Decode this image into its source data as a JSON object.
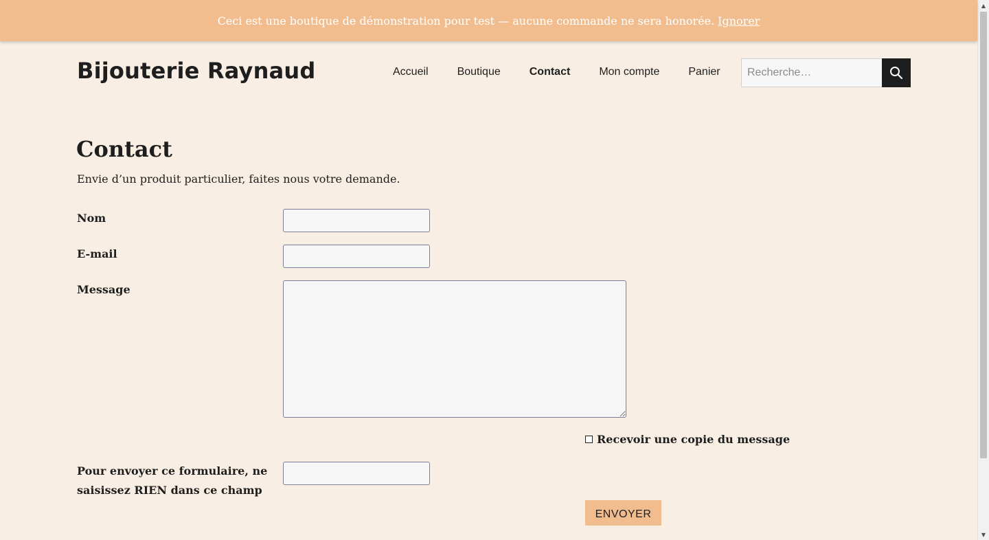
{
  "banner": {
    "text": "Ceci est une boutique de démonstration pour test — aucune commande ne sera honorée.",
    "dismiss_label": "Ignorer"
  },
  "site": {
    "title": "Bijouterie Raynaud"
  },
  "nav": {
    "items": [
      {
        "label": "Accueil"
      },
      {
        "label": "Boutique"
      },
      {
        "label": "Contact"
      },
      {
        "label": "Mon compte"
      },
      {
        "label": "Panier"
      }
    ],
    "active": "Contact"
  },
  "search": {
    "placeholder": "Recherche…",
    "icon": "search-icon"
  },
  "page": {
    "title": "Contact",
    "intro": "Envie d’un produit particulier, faites nous votre demande."
  },
  "form": {
    "name_label": "Nom",
    "email_label": "E-mail",
    "message_label": "Message",
    "copy_label": "Recevoir une copie du message",
    "honeypot_label_line1": "Pour envoyer ce formulaire, ne",
    "honeypot_label_line2": "saisissez RIEN dans ce champ",
    "submit_label": "ENVOYER"
  },
  "colors": {
    "background": "#f8eee3",
    "accent": "#f1bd8f",
    "text": "#1e1e1e"
  }
}
